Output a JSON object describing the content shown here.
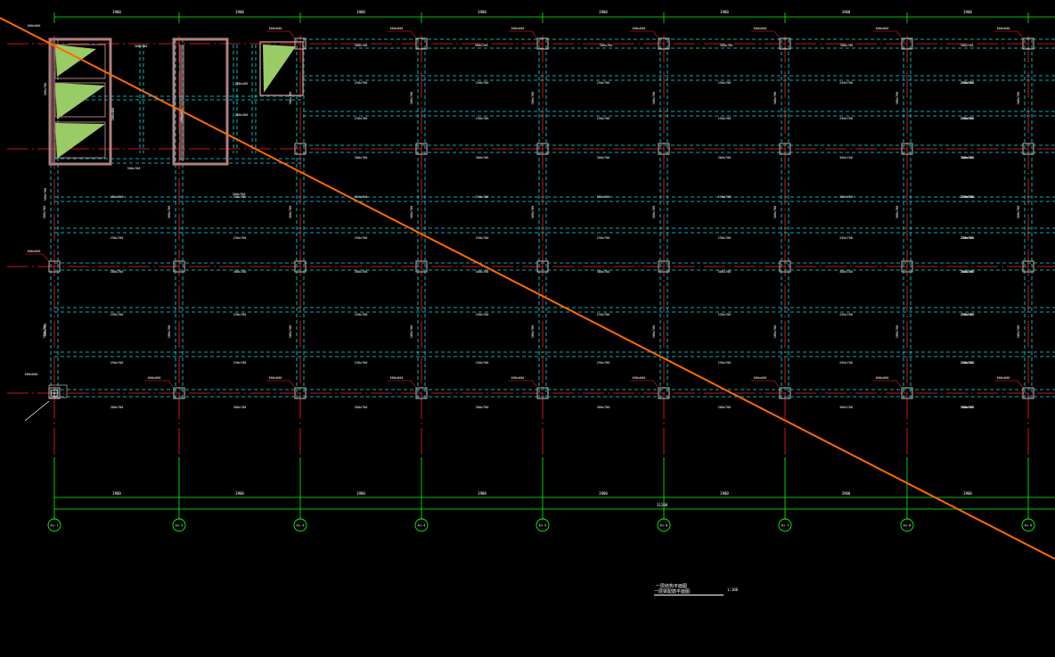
{
  "colors": {
    "background": "#000000",
    "axis_line": "#ff2020",
    "beam_line": "#00e5ee",
    "dimension": "#00ff00",
    "column": "#d7a6a6",
    "label": "#ffffff",
    "leader": "#ff2020",
    "diagonal": "#ff6a00",
    "wall_fill": "#99cc66",
    "wall_border": "#b08080"
  },
  "top_dimensions": [
    "3900",
    "3900",
    "3900",
    "3900",
    "3900",
    "3900",
    "3900",
    "3900"
  ],
  "bottom_dimensions": [
    "3900",
    "3900",
    "3900",
    "3900",
    "3900",
    "3900",
    "3900",
    "3900"
  ],
  "total_dimension": "31200",
  "axis_bubbles": [
    "A1-1",
    "A1-2",
    "A1-3",
    "A1-4",
    "A1-5",
    "A1-6",
    "A1-7",
    "A1-8",
    "A1-9"
  ],
  "beam_labels": {
    "primary": "300x700",
    "secondary": "250x700",
    "vertical": "300x700",
    "small": "200x400"
  },
  "column_tag": "600x600",
  "title_block": {
    "line1": "一层结构平面图",
    "line2": "一层梁配筋平面图",
    "scale": "1:100"
  }
}
